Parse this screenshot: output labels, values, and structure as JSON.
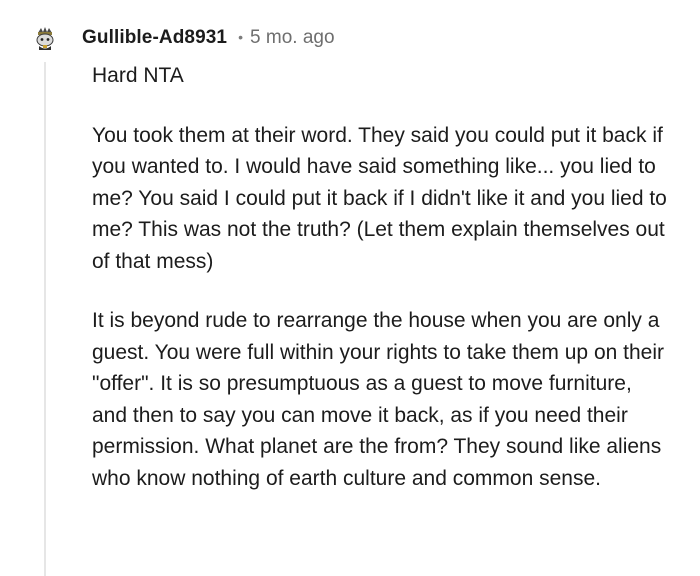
{
  "comment": {
    "author": "Gullible-Ad8931",
    "separator": "•",
    "timestamp": "5 mo. ago",
    "avatar_icon": "snoo-avatar-icon",
    "paragraphs": [
      "Hard NTA",
      "You took them at their word. They said you could put it back if you wanted to. I would have said something like... you lied to me? You said I could put it back if I didn't like it and you lied to me? This was not the truth? (Let them explain themselves out of that mess)",
      "It is beyond rude to rearrange the house when you are only a guest. You were full within your rights to take them up on their \"offer\". It is so presumptuous as a guest to move furniture, and then to say you can move it back, as if you need their permission. What planet are the from? They sound like aliens who know nothing of earth culture and common sense."
    ]
  }
}
